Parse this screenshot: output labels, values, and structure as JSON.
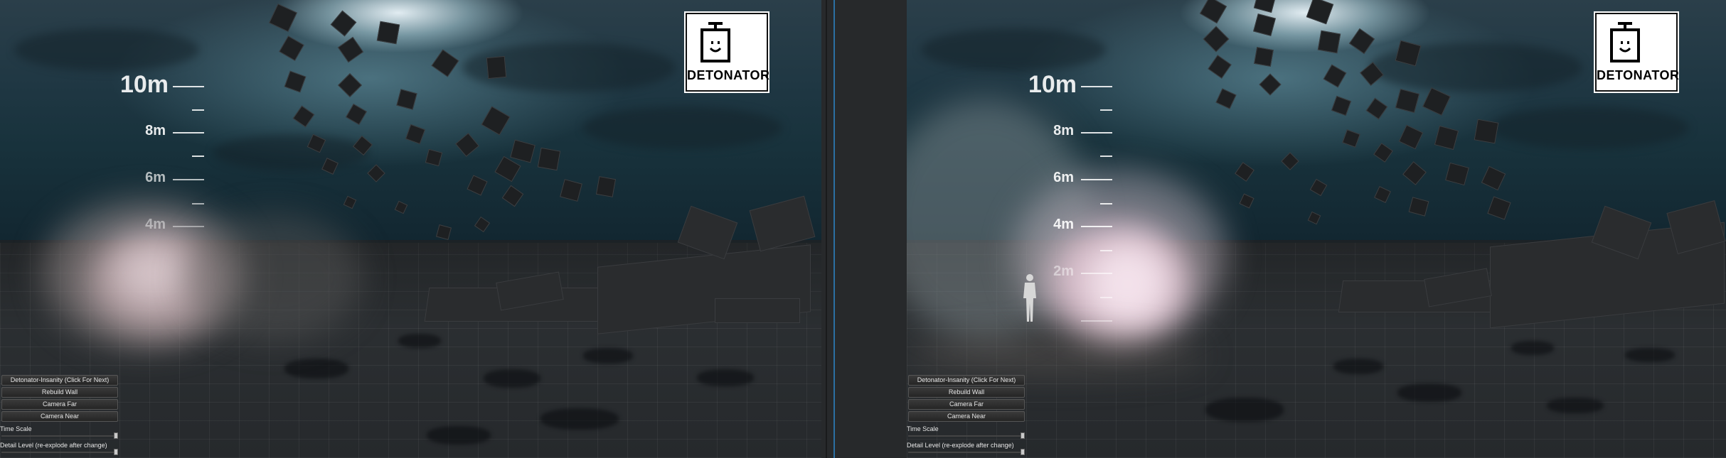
{
  "logo": {
    "title": "DETONATOR",
    "icon": "detonator-plunger-icon"
  },
  "ruler": {
    "labels": [
      {
        "text": "10m",
        "size": "big"
      },
      {
        "text": "8m",
        "size": "mid"
      },
      {
        "text": "6m",
        "size": "mid"
      },
      {
        "text": "4m",
        "size": "mid"
      },
      {
        "text": "2m",
        "size": "mid"
      }
    ]
  },
  "controls": {
    "buttons": [
      {
        "label": "Detonator-Insanity (Click For Next)"
      },
      {
        "label": "Rebuild Wall"
      },
      {
        "label": "Camera Far"
      },
      {
        "label": "Camera Near"
      }
    ],
    "sliders": [
      {
        "label": "Time Scale",
        "value": 1.0
      },
      {
        "label": "Detail Level (re-explode after change)",
        "value": 1.0
      }
    ]
  },
  "colors": {
    "sky": "#1f3743",
    "floor": "#2b2e31",
    "divider_accent": "#2b6fa3",
    "smoke_glow": "#f2c8d6"
  }
}
